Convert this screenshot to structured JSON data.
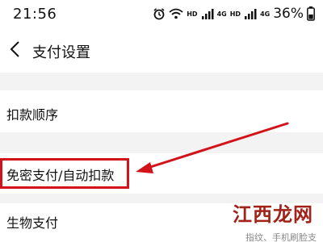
{
  "status_bar": {
    "time": "21:56",
    "net_tag_1": "HD",
    "net_tag_2": "4G",
    "net_tag_3": "HD",
    "net_tag_4": "4G",
    "battery": "36%",
    "icons": [
      "alarm-icon",
      "wifi-icon",
      "signal-icon",
      "signal-icon",
      "battery-icon"
    ]
  },
  "nav": {
    "title": "支付设置",
    "back_icon": "chevron-left-icon"
  },
  "list": {
    "items": [
      {
        "label": "扣款顺序"
      },
      {
        "label": "免密支付/自动扣款"
      },
      {
        "label": "生物支付"
      }
    ]
  },
  "annotation": {
    "highlight_color": "#d2131a",
    "arrow_color": "#d2131a"
  },
  "watermark": {
    "logo": "江西龙网",
    "caption": "指纹、手机刷脸支"
  }
}
